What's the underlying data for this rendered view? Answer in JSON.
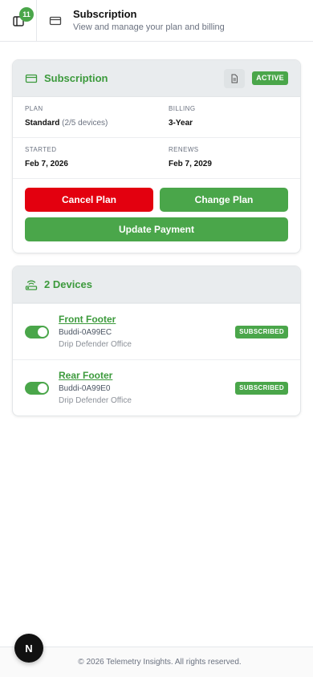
{
  "header": {
    "notification_count": "11",
    "title": "Subscription",
    "subtitle": "View and manage your plan and billing"
  },
  "subscription": {
    "title": "Subscription",
    "status": "ACTIVE",
    "plan_label": "PLAN",
    "plan_value": "Standard",
    "plan_devices": "(2/5 devices)",
    "billing_label": "BILLING",
    "billing_value": "3-Year",
    "started_label": "STARTED",
    "started_value": "Feb 7, 2026",
    "renews_label": "RENEWS",
    "renews_value": "Feb 7, 2029",
    "cancel_label": "Cancel Plan",
    "change_label": "Change Plan",
    "update_label": "Update Payment"
  },
  "devices": {
    "title": "2 Devices",
    "items": [
      {
        "name": "Front Footer",
        "id": "Buddi-0A99EC",
        "location": "Drip Defender Office",
        "status": "SUBSCRIBED",
        "enabled": true
      },
      {
        "name": "Rear Footer",
        "id": "Buddi-0A99E0",
        "location": "Drip Defender Office",
        "status": "SUBSCRIBED",
        "enabled": true
      }
    ]
  },
  "footer": {
    "text": "© 2026 Telemetry Insights. All rights reserved.",
    "fab_label": "N"
  },
  "colors": {
    "accent": "#4aa64a",
    "danger": "#e3000f"
  }
}
